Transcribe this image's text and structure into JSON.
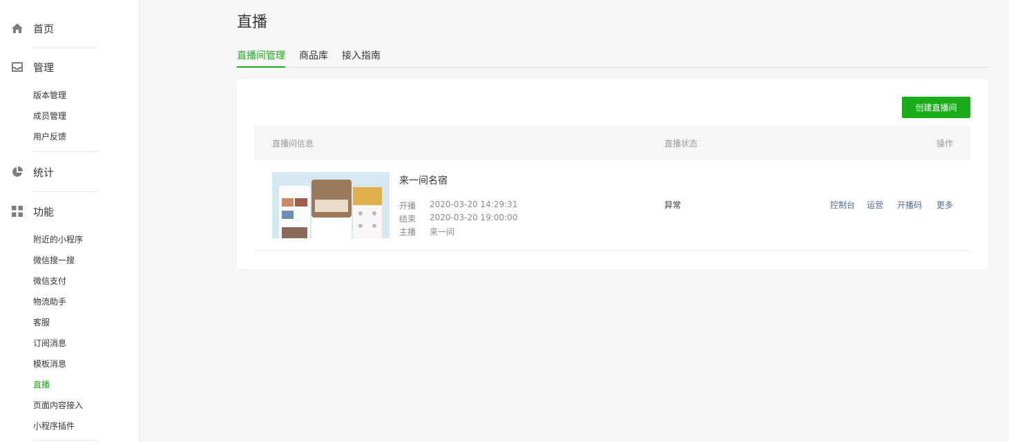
{
  "sidebar": {
    "home": {
      "label": "首页",
      "icon": "home-icon"
    },
    "manage": {
      "label": "管理",
      "icon": "inbox-icon",
      "items": [
        "版本管理",
        "成员管理",
        "用户反馈"
      ]
    },
    "stats": {
      "label": "统计",
      "icon": "pie-chart-icon"
    },
    "features": {
      "label": "功能",
      "icon": "grid-icon",
      "items": [
        "附近的小程序",
        "微信搜一搜",
        "微信支付",
        "物流助手",
        "客服",
        "订阅消息",
        "模板消息",
        "直播",
        "页面内容接入",
        "小程序插件"
      ],
      "active": "直播"
    }
  },
  "page": {
    "title": "直播",
    "tabs": [
      "直播间管理",
      "商品库",
      "接入指南"
    ],
    "active_tab": "直播间管理",
    "create_button": "创建直播间",
    "table": {
      "headers": {
        "info": "直播间信息",
        "status": "直播状态",
        "ops": "操作"
      },
      "rows": [
        {
          "name": "来一间名宿",
          "start_label": "开播",
          "start": "2020-03-20 14:29:31",
          "end_label": "结束",
          "end": "2020-03-20 19:00:00",
          "host_label": "主播",
          "host": "来一间",
          "status": "异常",
          "ops": [
            "控制台",
            "运营",
            "开播码",
            "更多"
          ]
        }
      ]
    }
  },
  "colors": {
    "accent": "#1aad19",
    "link": "#576b95"
  }
}
